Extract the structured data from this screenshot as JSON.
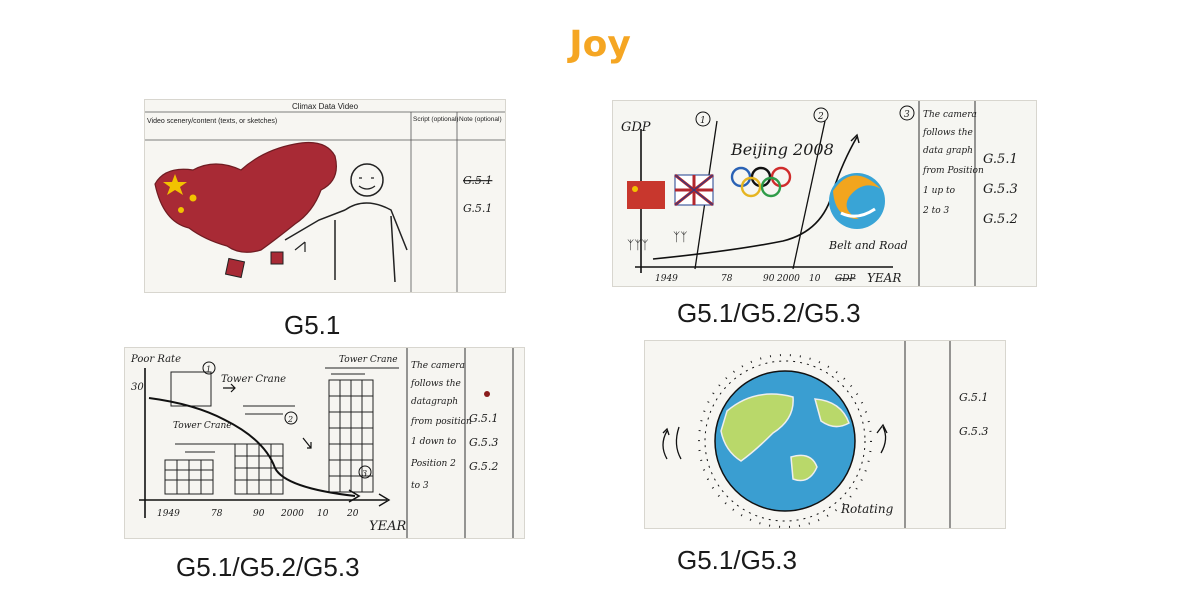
{
  "page": {
    "title": "Joy"
  },
  "panels": [
    {
      "caption": "G5.1",
      "header": {
        "title": "Climax Data Video",
        "col_scene": "Video scenery/content (texts, or sketches)",
        "col_script": "Script (optional)",
        "col_note": "Note (optional)"
      },
      "notes": [
        "G.5.1",
        "G.5.1"
      ]
    },
    {
      "caption": "G5.1/G5.2/G5.3",
      "axis_y": "GDP",
      "axis_x": "YEAR",
      "markers": [
        "1",
        "2",
        "3"
      ],
      "ticks": [
        "1949",
        "78",
        "90",
        "2000",
        "10",
        "GDP"
      ],
      "labels": {
        "olympics": "Beijing 2008",
        "belt": "Belt and Road"
      },
      "camera_note": [
        "The camera",
        "follows the",
        "data graph",
        "from Position",
        "1 up to",
        "2 to 3"
      ],
      "codes": [
        "G.5.1",
        "G.5.3",
        "G.5.2"
      ]
    },
    {
      "caption": "G5.1/G5.2/G5.3",
      "axis_y": "Poor Rate",
      "y_tick": "30",
      "axis_x": "YEAR",
      "markers": [
        "1",
        "2",
        "3"
      ],
      "labels": [
        "Tower Crane",
        "Tower Crane",
        "Tower Crane"
      ],
      "ticks": [
        "1949",
        "78",
        "90",
        "2000",
        "10",
        "20"
      ],
      "camera_note": [
        "The camera",
        "follows the",
        "datagraph",
        "from position",
        "1 down to",
        "Position 2",
        "to 3"
      ],
      "codes": [
        "G.5.1",
        "G.5.3",
        "G.5.2"
      ]
    },
    {
      "caption": "G5.1/G5.3",
      "label": "Rotating",
      "codes": [
        "G.5.1",
        "G.5.3"
      ]
    }
  ]
}
